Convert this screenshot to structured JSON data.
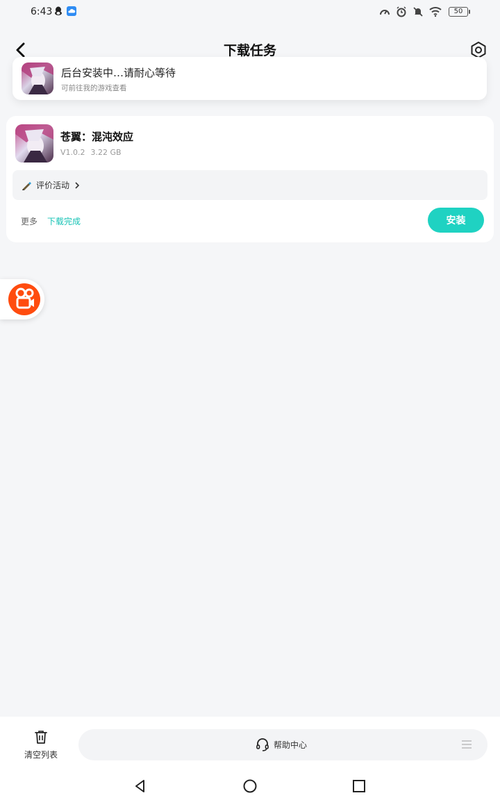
{
  "status_bar": {
    "time": "6:43",
    "battery": "50"
  },
  "header": {
    "title": "下载任务"
  },
  "toast": {
    "title": "后台安装中…请耐心等待",
    "subtitle": "可前往我的游戏查看"
  },
  "task": {
    "name": "苍翼：混沌效应",
    "version": "V1.0.2",
    "size": "3.22 GB",
    "review_label": "评价活动",
    "more_label": "更多",
    "status": "下载完成",
    "install_label": "安装"
  },
  "bottom_bar": {
    "clear_label": "清空列表",
    "help_label": "帮助中心"
  },
  "colors": {
    "accent": "#1fd2c2",
    "accent_text": "#18c3b6",
    "bubble": "#ff4c0f",
    "background": "#f5f6f8"
  },
  "icons": {
    "back": "chevron-left-icon",
    "settings": "hexagon-gear-icon",
    "review": "pen-icon",
    "clear": "trash-icon",
    "help": "headset-icon",
    "menu": "menu-lines-icon"
  }
}
